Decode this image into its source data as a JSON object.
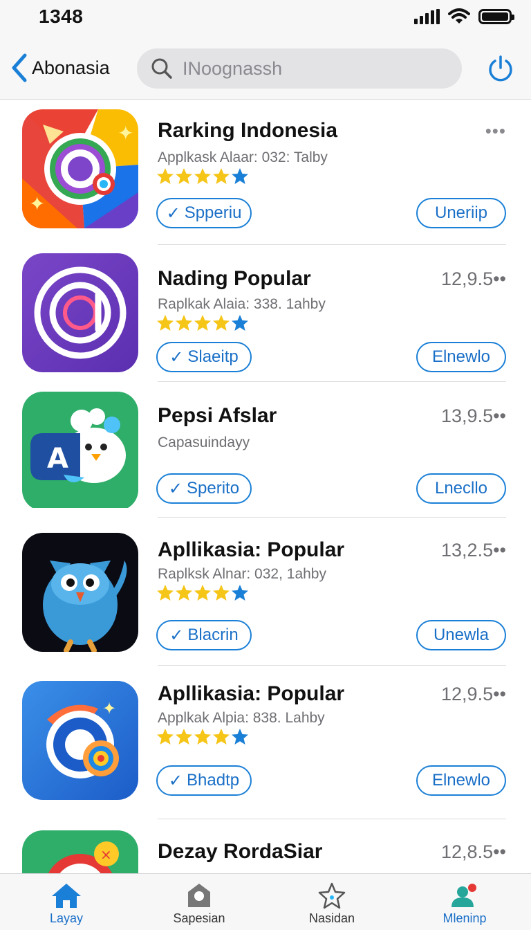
{
  "status_bar": {
    "time": "1348"
  },
  "nav": {
    "back_label": "Abonasia",
    "search_placeholder": "INoognassh"
  },
  "apps": [
    {
      "name": "Rarking Indonesia",
      "subtitle": "Applkask Alaar: 032: Talby",
      "rating": 4.5,
      "price": "",
      "has_more": true,
      "left_button": "Spperiu",
      "right_button": "Uneriip"
    },
    {
      "name": "Nading Popular",
      "subtitle": "Raplkak Alaia: 338. 1ahby",
      "rating": 4.5,
      "price": "12,9.5••",
      "has_more": false,
      "left_button": "Slaeitp",
      "right_button": "Elnewlo"
    },
    {
      "name": "Pepsi Afslar",
      "subtitle": "Capasuindayy",
      "rating": null,
      "price": "13,9.5••",
      "has_more": false,
      "left_button": "Sperito",
      "right_button": "Lnecllo"
    },
    {
      "name": "Apllikasia: Popular",
      "subtitle": "Raplksk Alnar: 032, 1ahby",
      "rating": 4.5,
      "price": "13,2.5••",
      "has_more": false,
      "left_button": "Blacrin",
      "right_button": "Unewla"
    },
    {
      "name": "Apllikasia: Popular",
      "subtitle": "Applkak Alpia: 838. Lahby",
      "rating": 4.5,
      "price": "12,9.5••",
      "has_more": false,
      "left_button": "Bhadtp",
      "right_button": "Elnewlo"
    },
    {
      "name": "Dezay RordaSiar",
      "subtitle": "",
      "rating": null,
      "price": "12,8.5••",
      "has_more": false,
      "left_button": "",
      "right_button": ""
    }
  ],
  "tabs": [
    {
      "label": "Layay",
      "icon": "home-icon",
      "active": true
    },
    {
      "label": "Sapesian",
      "icon": "tag-icon",
      "active": false
    },
    {
      "label": "Nasidan",
      "icon": "star-icon",
      "active": false
    },
    {
      "label": "Mleninp",
      "icon": "people-icon",
      "active": true
    }
  ],
  "colors": {
    "accent": "#1a7fd6",
    "star_gold": "#f5c518",
    "star_blue": "#1a7fd6"
  }
}
